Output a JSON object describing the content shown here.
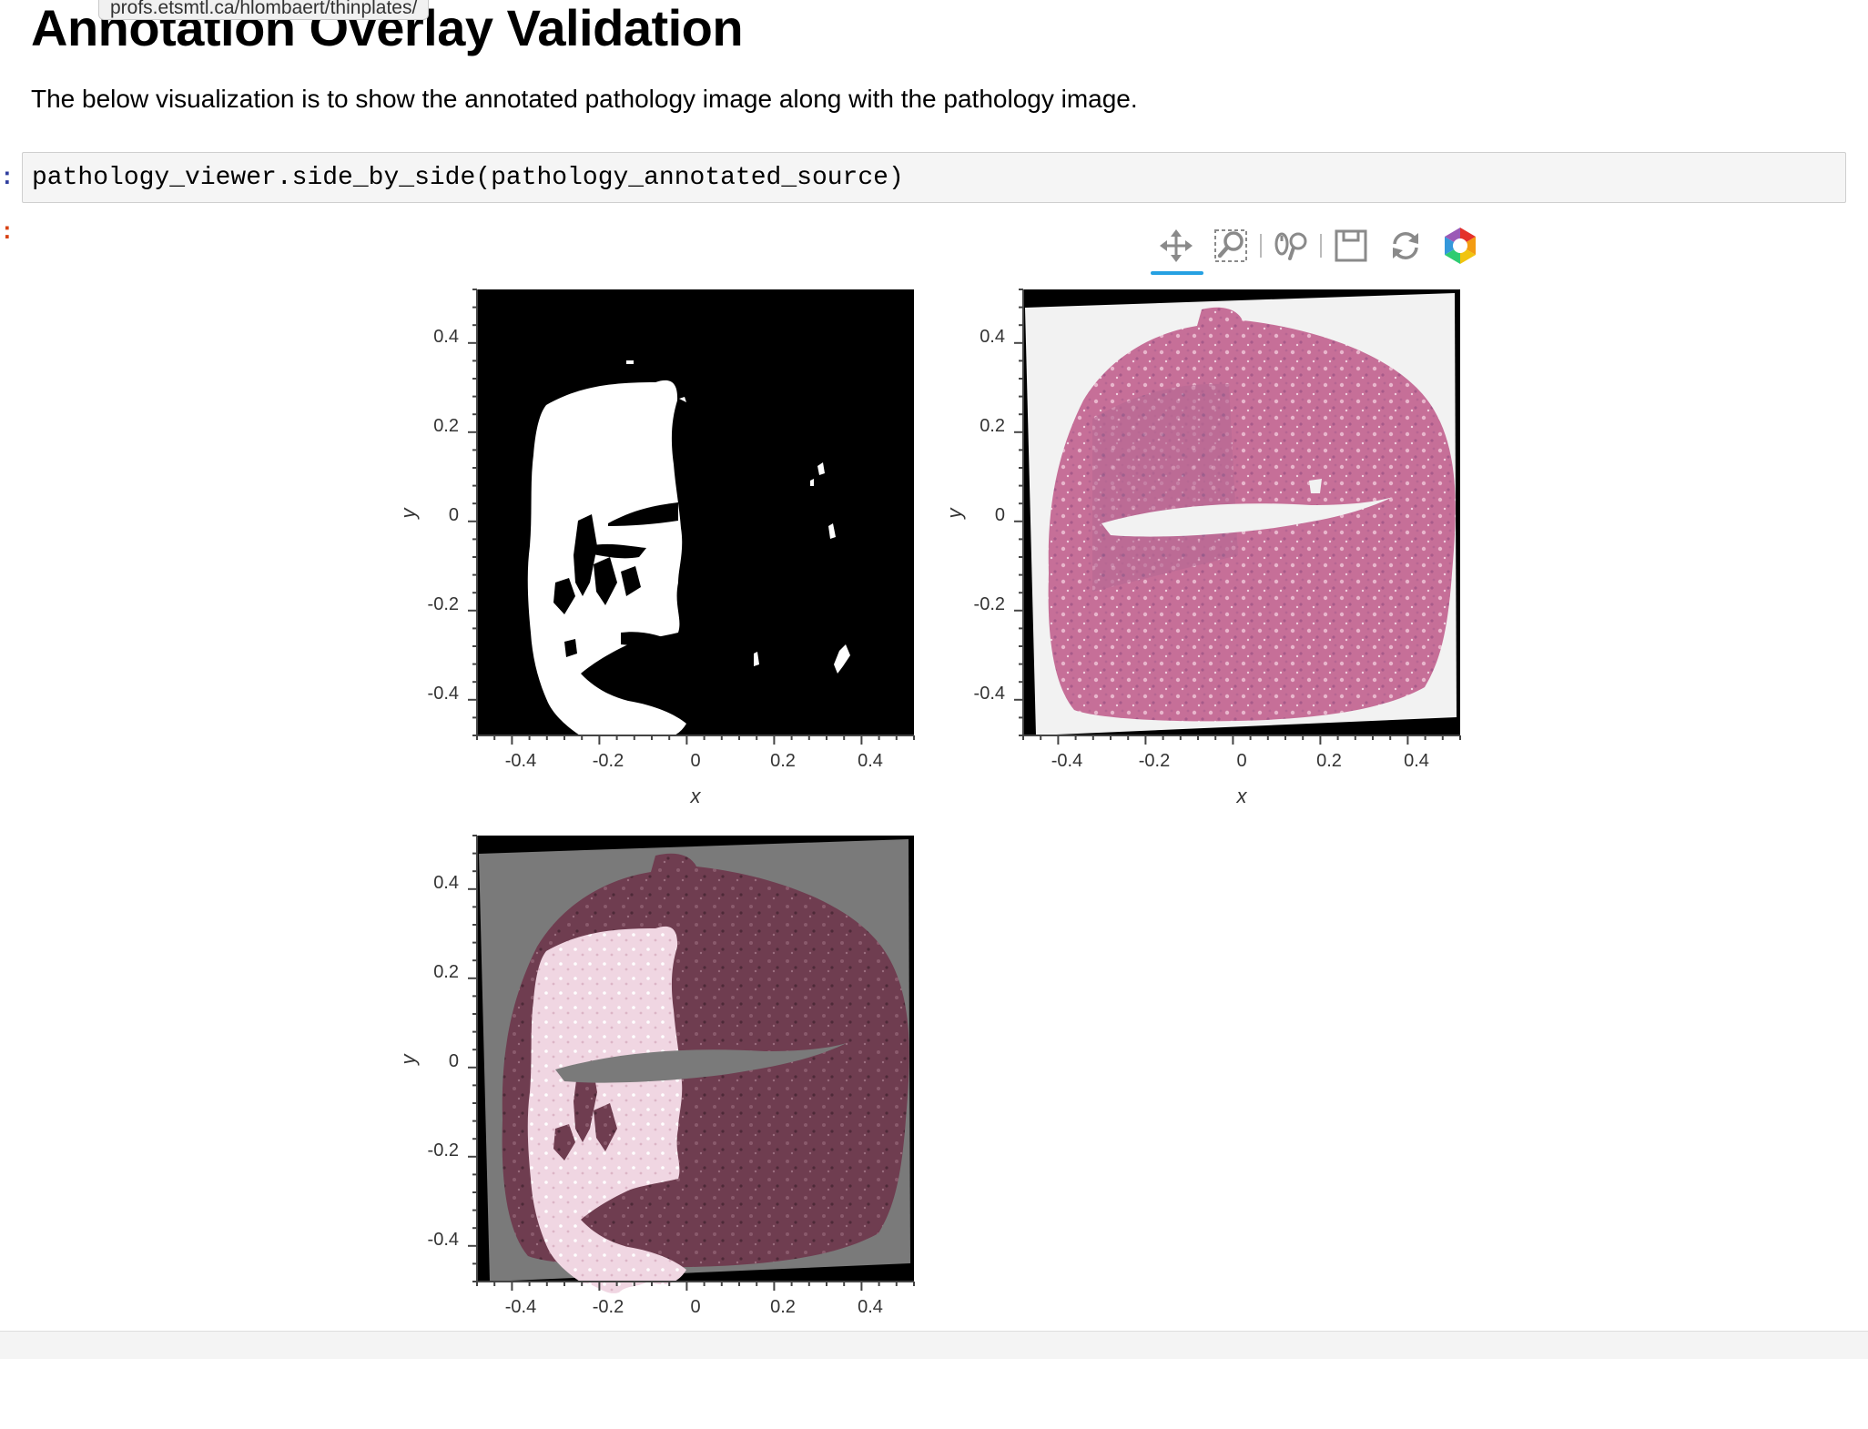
{
  "browser": {
    "url_tooltip": "profs.etsmtl.ca/hlombaert/thinplates/"
  },
  "notebook": {
    "title": "Annotation Overlay Validation",
    "intro_text": "The below visualization is to show the annotated pathology image along with the pathology image.",
    "input_prompt": ":",
    "output_prompt": ":",
    "code": "pathology_viewer.side_by_side(pathology_annotated_source)"
  },
  "toolbar": {
    "tools": [
      {
        "name": "pan-tool",
        "icon": "move-arrows-icon",
        "active": true
      },
      {
        "name": "box-zoom-tool",
        "icon": "box-zoom-icon",
        "active": false
      },
      {
        "name": "wheel-zoom-tool",
        "icon": "wheel-zoom-icon",
        "active": false
      },
      {
        "name": "save-tool",
        "icon": "save-icon",
        "active": false
      },
      {
        "name": "reset-tool",
        "icon": "reset-icon",
        "active": false
      },
      {
        "name": "bokeh-logo",
        "icon": "bokeh-logo-icon",
        "active": false
      }
    ]
  },
  "colors": {
    "toolbar_active": "#26a1e2",
    "tissue_pink": "#c66f98",
    "overlay_tissue": "#6f3d50",
    "overlay_background": "#7a7a7a",
    "annotation_highlight": "#f0d6e2"
  },
  "plots": [
    {
      "name": "annotation-mask-plot",
      "xlabel": "x",
      "ylabel": "y",
      "xticks": [
        "-0.4",
        "-0.2",
        "0",
        "0.2",
        "0.4"
      ],
      "yticks": [
        "0.4",
        "0.2",
        "0",
        "-0.2",
        "-0.4"
      ]
    },
    {
      "name": "pathology-image-plot",
      "xlabel": "x",
      "ylabel": "y",
      "xticks": [
        "-0.4",
        "-0.2",
        "0",
        "0.2",
        "0.4"
      ],
      "yticks": [
        "0.4",
        "0.2",
        "0",
        "-0.2",
        "-0.4"
      ]
    },
    {
      "name": "overlay-plot",
      "xlabel": "x",
      "ylabel": "y",
      "xticks": [
        "-0.4",
        "-0.2",
        "0",
        "0.2",
        "0.4"
      ],
      "yticks": [
        "0.4",
        "0.2",
        "0",
        "-0.2",
        "-0.4"
      ]
    }
  ]
}
